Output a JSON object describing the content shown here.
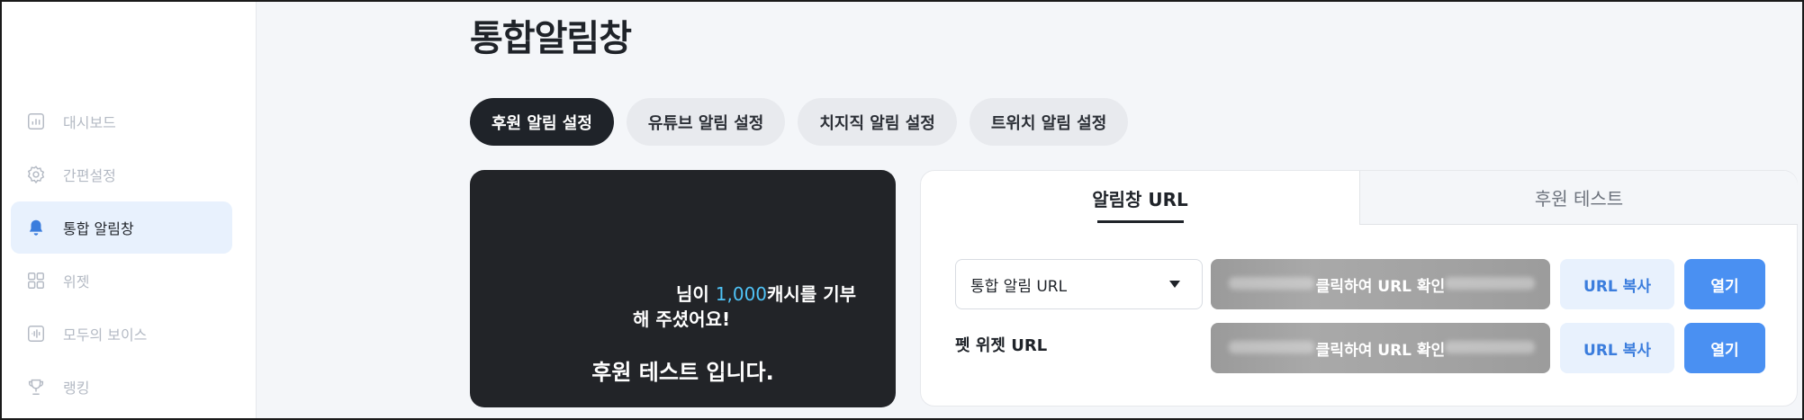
{
  "page_title": "통합알림창",
  "sidebar": {
    "items": [
      {
        "label": "대시보드",
        "icon": "chart-icon",
        "active": false
      },
      {
        "label": "간편설정",
        "icon": "gear-icon",
        "active": false
      },
      {
        "label": "통합 알림창",
        "icon": "bell-icon",
        "active": true
      },
      {
        "label": "위젯",
        "icon": "grid-icon",
        "active": false
      },
      {
        "label": "모두의 보이스",
        "icon": "voice-icon",
        "active": false
      },
      {
        "label": "랭킹",
        "icon": "trophy-icon",
        "active": false
      }
    ]
  },
  "tabs": [
    "후원 알림 설정",
    "유튜브 알림 설정",
    "치지직 알림 설정",
    "트위치 알림 설정"
  ],
  "preview": {
    "line1_prefix": "님이 ",
    "amount": "1,000",
    "line1_suffix": "캐시를 기부",
    "line2": "해 주셨어요!",
    "line3": "후원 테스트 입니다."
  },
  "card": {
    "tab_url": "알림창 URL",
    "tab_test": "후원 테스트",
    "dropdown_value": "통합 알림 URL",
    "row2_label": "펫 위젯 URL",
    "url_overlay": "클릭하여 URL 확인",
    "copy_label": "URL 복사",
    "open_label": "열기"
  },
  "colors": {
    "accent": "#4a90f2",
    "active_bg": "#e8f1fd",
    "dark": "#1f2329",
    "amount": "#4fc3f7"
  }
}
